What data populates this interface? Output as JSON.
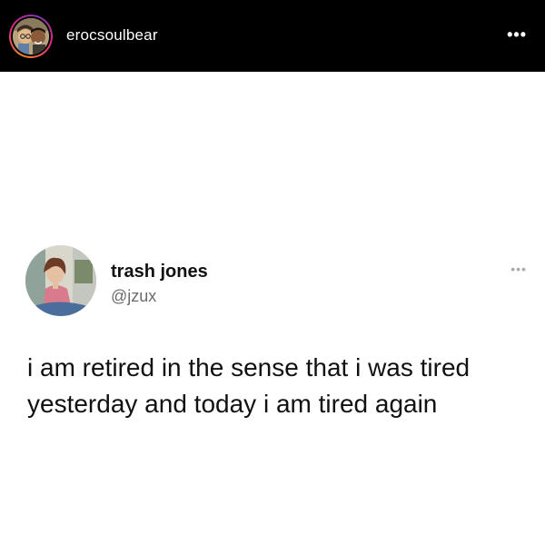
{
  "post": {
    "username": "erocsoulbear",
    "more_glyph": "•••",
    "avatar_icon": "profile-photo-icon"
  },
  "tweet": {
    "display_name": "trash jones",
    "handle": "@jzux",
    "more_glyph": "•••",
    "avatar_icon": "profile-photo-icon",
    "text": "i am retired in the sense that i was tired yesterday and today i am tired again"
  },
  "colors": {
    "header_bg": "#000000",
    "page_bg": "#ffffff",
    "text_primary": "#111111",
    "text_secondary": "#6b6b6b",
    "story_ring": "#dd2a7b"
  }
}
